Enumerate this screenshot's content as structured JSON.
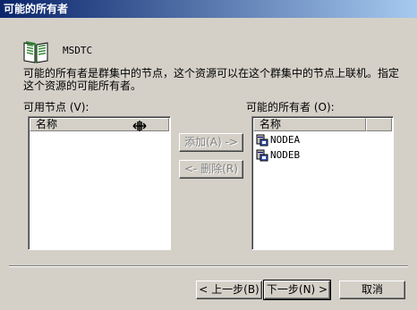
{
  "window": {
    "title": "可能的所有者"
  },
  "resource": {
    "name": "MSDTC",
    "icon": "book-icon"
  },
  "description": "可能的所有者是群集中的节点，这个资源可以在这个群集中的节点上联机。指定这个资源的可能所有者。",
  "available_nodes": {
    "label": "可用节点 (V):",
    "column_header": "名称",
    "items": []
  },
  "possible_owners": {
    "label": "可能的所有者 (O):",
    "column_header": "名称",
    "items": [
      "NODEA",
      "NODEB"
    ]
  },
  "buttons": {
    "add": "添加(A) ->",
    "remove": "<- 删除(R)",
    "back": "< 上一步(B)",
    "next": "下一步(N) >",
    "cancel": "取消"
  },
  "colors": {
    "title_start": "#0a246a",
    "title_end": "#a6caf0",
    "face": "#d4d0c8"
  }
}
